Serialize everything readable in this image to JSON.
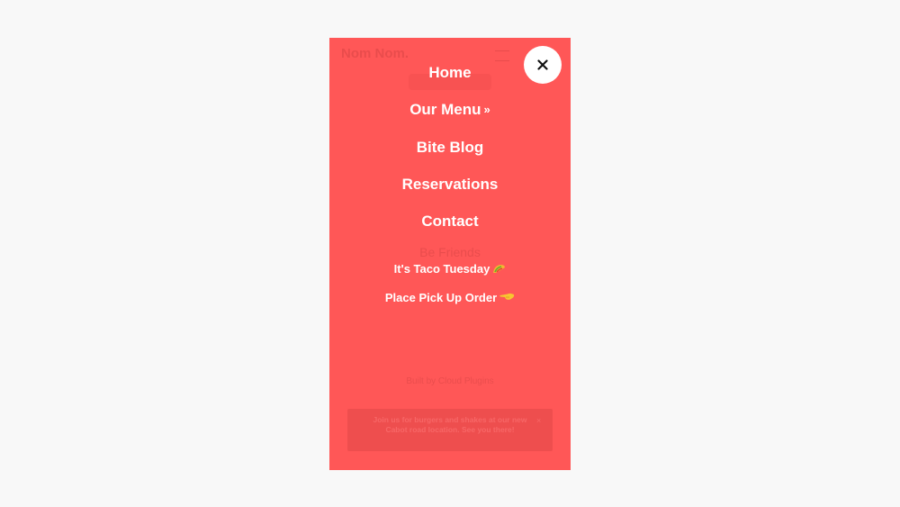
{
  "app": {
    "brand": "Nom Nom."
  },
  "menu": {
    "items": [
      {
        "label": "Home"
      },
      {
        "label": "Our Menu",
        "chevron": "»"
      },
      {
        "label": "Bite Blog"
      },
      {
        "label": "Reservations"
      },
      {
        "label": "Contact"
      }
    ],
    "promos": [
      {
        "label": "It's Taco Tuesday",
        "icon": "taco-icon"
      },
      {
        "label": "Place Pick Up Order",
        "icon": "pointing-hand-icon"
      }
    ],
    "close_icon": "close-icon",
    "close_glyph": "✕"
  },
  "background_page": {
    "section_label": "Be Friends",
    "credit": "Built by Cloud Plugins",
    "banner_text": "Join us for burgers and shakes at our new Cabot road location. See you there!",
    "banner_close": "×"
  },
  "colors": {
    "overlay": "#ff5757",
    "page_bg": "#f8f8f8",
    "menu_text": "#ffffff",
    "close_bg": "#ffffff"
  }
}
